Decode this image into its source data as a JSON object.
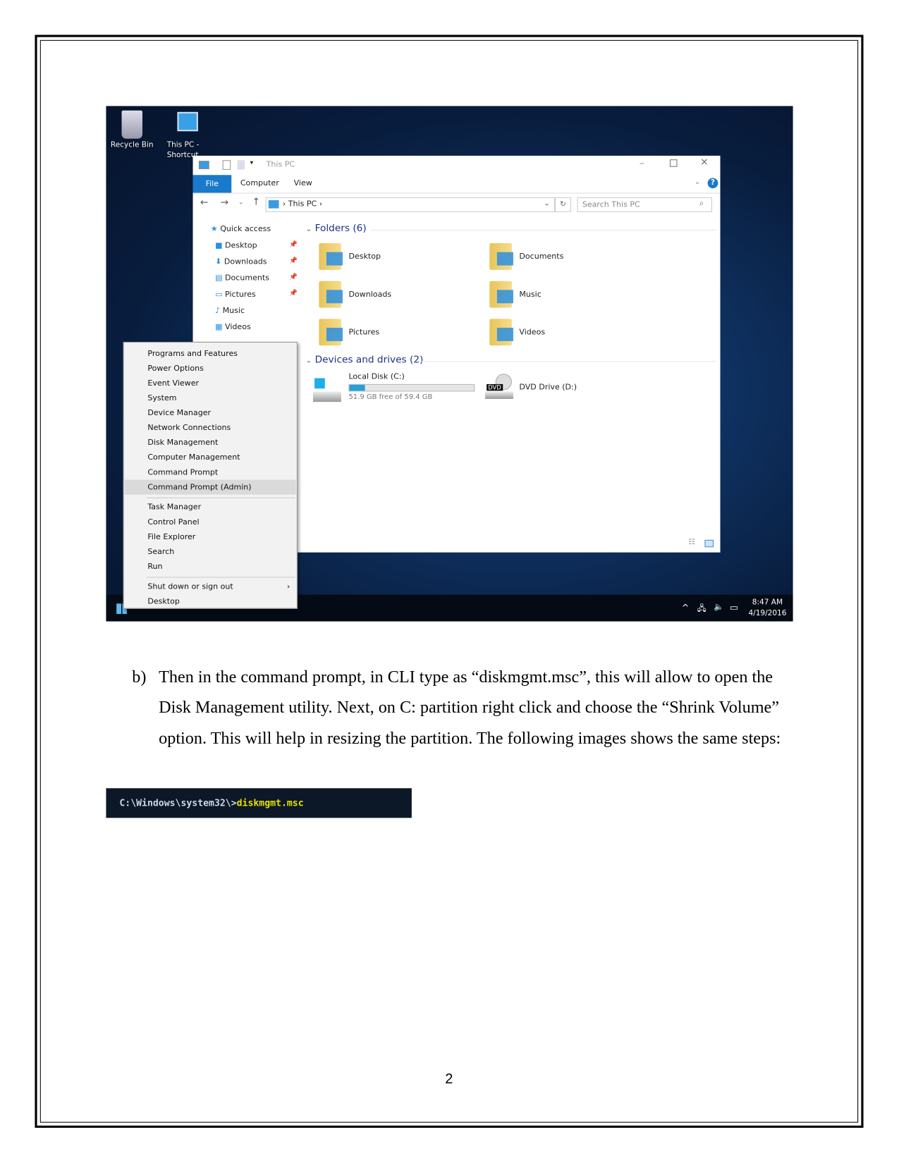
{
  "desktop": {
    "icons": [
      {
        "label": "Recycle Bin",
        "icon": "recycle-bin-icon"
      },
      {
        "label": "This PC - Shortcut",
        "label_visible": "This PC -",
        "label_line2": "Shortc",
        "icon": "computer-icon"
      }
    ]
  },
  "explorer": {
    "title": "This PC",
    "ribbon_tabs": [
      "File",
      "Computer",
      "View"
    ],
    "address": {
      "path": "This PC"
    },
    "search_placeholder": "Search This PC",
    "nav": {
      "quick_access": "Quick access",
      "items": [
        {
          "label": "Desktop",
          "pinned": true
        },
        {
          "label": "Downloads",
          "pinned": true
        },
        {
          "label": "Documents",
          "pinned": true
        },
        {
          "label": "Pictures",
          "pinned": true
        },
        {
          "label": "Music",
          "pinned": false
        },
        {
          "label": "Videos",
          "pinned": false
        }
      ]
    },
    "folders_header": "Folders (6)",
    "folders": [
      "Desktop",
      "Documents",
      "Downloads",
      "Music",
      "Pictures",
      "Videos"
    ],
    "devices_header": "Devices and drives (2)",
    "drives": [
      {
        "name": "Local Disk (C:)",
        "free": "51.9 GB free of 59.4 GB",
        "used_percent": 12.6
      },
      {
        "name": "DVD Drive (D:)",
        "badge": "DVD"
      }
    ]
  },
  "context_menu": {
    "items": [
      "Programs and Features",
      "Power Options",
      "Event Viewer",
      "System",
      "Device Manager",
      "Network Connections",
      "Disk Management",
      "Computer Management",
      "Command Prompt",
      "Command Prompt (Admin)",
      "Task Manager",
      "Control Panel",
      "File Explorer",
      "Search",
      "Run",
      "Shut down or sign out",
      "Desktop"
    ],
    "hovered": "Command Prompt (Admin)"
  },
  "taskbar": {
    "time": "8:47 AM",
    "date": "4/19/2016"
  },
  "paragraph": {
    "label": "b)",
    "text": "Then in the command prompt, in CLI type as “diskmgmt.msc”, this will allow to open the Disk Management utility. Next, on C: partition right click and choose the “Shrink Volume” option. This will help in resizing the partition. The following images shows the same steps:"
  },
  "cmd": {
    "prompt": "C:\\Windows\\system32\\>",
    "command": "diskmgmt.msc",
    "prompt_color": "#c8d8e8",
    "command_color": "#e8e000"
  },
  "page_number": "2",
  "colors": {
    "accent": "#1979ca",
    "desktop": "#0f3262"
  }
}
